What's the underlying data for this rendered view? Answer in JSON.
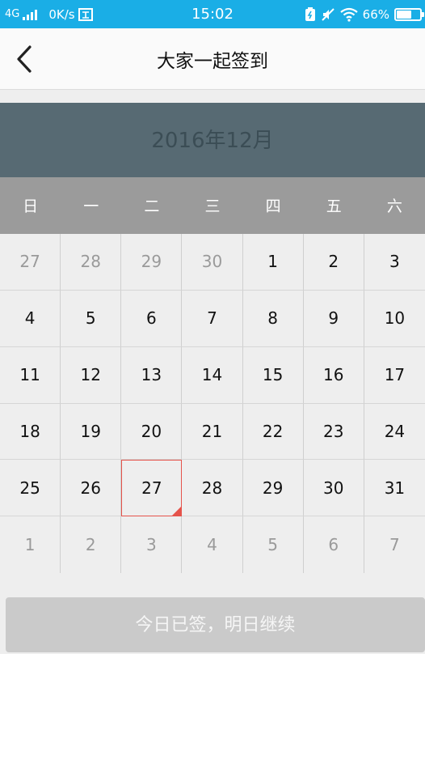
{
  "status_bar": {
    "network": "4G",
    "speed": "0K/s",
    "time": "15:02",
    "battery": "66%",
    "battery_level": 0.66,
    "color": "#1aaee6"
  },
  "header": {
    "title": "大家一起签到",
    "back_icon": "chevron-left-icon"
  },
  "calendar": {
    "month_label": "2016年12月",
    "weekdays": [
      "日",
      "一",
      "二",
      "三",
      "四",
      "五",
      "六"
    ],
    "days": [
      {
        "label": "27",
        "other": true
      },
      {
        "label": "28",
        "other": true
      },
      {
        "label": "29",
        "other": true
      },
      {
        "label": "30",
        "other": true
      },
      {
        "label": "1",
        "other": false
      },
      {
        "label": "2",
        "other": false
      },
      {
        "label": "3",
        "other": false
      },
      {
        "label": "4",
        "other": false
      },
      {
        "label": "5",
        "other": false
      },
      {
        "label": "6",
        "other": false
      },
      {
        "label": "7",
        "other": false
      },
      {
        "label": "8",
        "other": false
      },
      {
        "label": "9",
        "other": false
      },
      {
        "label": "10",
        "other": false
      },
      {
        "label": "11",
        "other": false
      },
      {
        "label": "12",
        "other": false
      },
      {
        "label": "13",
        "other": false
      },
      {
        "label": "14",
        "other": false
      },
      {
        "label": "15",
        "other": false
      },
      {
        "label": "16",
        "other": false
      },
      {
        "label": "17",
        "other": false
      },
      {
        "label": "18",
        "other": false
      },
      {
        "label": "19",
        "other": false
      },
      {
        "label": "20",
        "other": false
      },
      {
        "label": "21",
        "other": false
      },
      {
        "label": "22",
        "other": false
      },
      {
        "label": "23",
        "other": false
      },
      {
        "label": "24",
        "other": false
      },
      {
        "label": "25",
        "other": false
      },
      {
        "label": "26",
        "other": false
      },
      {
        "label": "27",
        "other": false,
        "today": true
      },
      {
        "label": "28",
        "other": false
      },
      {
        "label": "29",
        "other": false
      },
      {
        "label": "30",
        "other": false
      },
      {
        "label": "31",
        "other": false
      },
      {
        "label": "1",
        "other": true
      },
      {
        "label": "2",
        "other": true
      },
      {
        "label": "3",
        "other": true
      },
      {
        "label": "4",
        "other": true
      },
      {
        "label": "5",
        "other": true
      },
      {
        "label": "6",
        "other": true
      },
      {
        "label": "7",
        "other": true
      }
    ],
    "today_marker_color": "#e5534b"
  },
  "sign_button": {
    "label": "今日已签，明日继续"
  }
}
